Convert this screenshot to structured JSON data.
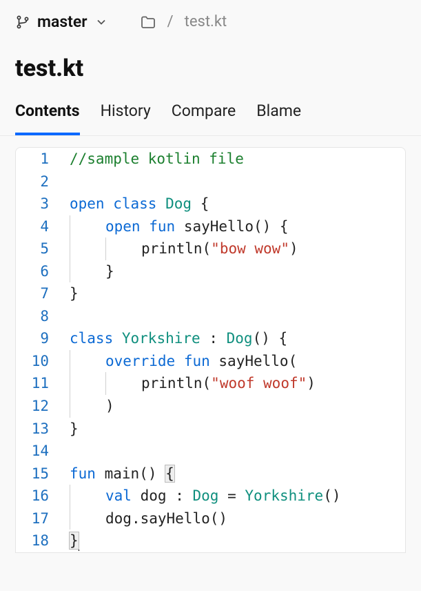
{
  "branch": {
    "name": "master"
  },
  "breadcrumb": {
    "file": "test.kt"
  },
  "title": "test.kt",
  "tabs": [
    {
      "label": "Contents",
      "active": true
    },
    {
      "label": "History",
      "active": false
    },
    {
      "label": "Compare",
      "active": false
    },
    {
      "label": "Blame",
      "active": false
    }
  ],
  "code": {
    "lines": [
      {
        "n": 1,
        "indent": 0,
        "guides": [],
        "tokens": [
          {
            "t": "comment",
            "v": "//sample kotlin file"
          }
        ]
      },
      {
        "n": 2,
        "indent": 0,
        "guides": [],
        "tokens": []
      },
      {
        "n": 3,
        "indent": 0,
        "guides": [],
        "tokens": [
          {
            "t": "modifier",
            "v": "open"
          },
          {
            "t": "sp",
            "v": " "
          },
          {
            "t": "keyword",
            "v": "class"
          },
          {
            "t": "sp",
            "v": " "
          },
          {
            "t": "type",
            "v": "Dog"
          },
          {
            "t": "sp",
            "v": " "
          },
          {
            "t": "punc",
            "v": "{"
          }
        ]
      },
      {
        "n": 4,
        "indent": 1,
        "guides": [
          0
        ],
        "tokens": [
          {
            "t": "modifier",
            "v": "open"
          },
          {
            "t": "sp",
            "v": " "
          },
          {
            "t": "keyword",
            "v": "fun"
          },
          {
            "t": "sp",
            "v": " "
          },
          {
            "t": "fn",
            "v": "sayHello"
          },
          {
            "t": "punc",
            "v": "() {"
          }
        ]
      },
      {
        "n": 5,
        "indent": 2,
        "guides": [
          0,
          1
        ],
        "tokens": [
          {
            "t": "fn",
            "v": "println"
          },
          {
            "t": "punc",
            "v": "("
          },
          {
            "t": "string",
            "v": "\"bow wow\""
          },
          {
            "t": "punc",
            "v": ")"
          }
        ]
      },
      {
        "n": 6,
        "indent": 1,
        "guides": [
          0
        ],
        "tokens": [
          {
            "t": "punc",
            "v": "}"
          }
        ]
      },
      {
        "n": 7,
        "indent": 0,
        "guides": [],
        "tokens": [
          {
            "t": "punc",
            "v": "}"
          }
        ]
      },
      {
        "n": 8,
        "indent": 0,
        "guides": [],
        "tokens": []
      },
      {
        "n": 9,
        "indent": 0,
        "guides": [],
        "tokens": [
          {
            "t": "keyword",
            "v": "class"
          },
          {
            "t": "sp",
            "v": " "
          },
          {
            "t": "type",
            "v": "Yorkshire"
          },
          {
            "t": "sp",
            "v": " "
          },
          {
            "t": "punc",
            "v": ":"
          },
          {
            "t": "sp",
            "v": " "
          },
          {
            "t": "type",
            "v": "Dog"
          },
          {
            "t": "punc",
            "v": "() {"
          }
        ]
      },
      {
        "n": 10,
        "indent": 1,
        "guides": [
          0
        ],
        "tokens": [
          {
            "t": "modifier",
            "v": "override"
          },
          {
            "t": "sp",
            "v": " "
          },
          {
            "t": "keyword",
            "v": "fun"
          },
          {
            "t": "sp",
            "v": " "
          },
          {
            "t": "fn",
            "v": "sayHello"
          },
          {
            "t": "punc",
            "v": "("
          }
        ]
      },
      {
        "n": 11,
        "indent": 2,
        "guides": [
          0,
          1
        ],
        "tokens": [
          {
            "t": "fn",
            "v": "println"
          },
          {
            "t": "punc",
            "v": "("
          },
          {
            "t": "string",
            "v": "\"woof woof\""
          },
          {
            "t": "punc",
            "v": ")"
          }
        ]
      },
      {
        "n": 12,
        "indent": 1,
        "guides": [
          0
        ],
        "tokens": [
          {
            "t": "punc",
            "v": ")"
          }
        ]
      },
      {
        "n": 13,
        "indent": 0,
        "guides": [],
        "tokens": [
          {
            "t": "punc",
            "v": "}"
          }
        ]
      },
      {
        "n": 14,
        "indent": 0,
        "guides": [],
        "tokens": []
      },
      {
        "n": 15,
        "indent": 0,
        "guides": [],
        "tokens": [
          {
            "t": "keyword",
            "v": "fun"
          },
          {
            "t": "sp",
            "v": " "
          },
          {
            "t": "fn",
            "v": "main"
          },
          {
            "t": "punc",
            "v": "() "
          },
          {
            "t": "punc",
            "v": "{",
            "hl": true
          }
        ]
      },
      {
        "n": 16,
        "indent": 1,
        "guides": [
          0
        ],
        "tokens": [
          {
            "t": "keyword",
            "v": "val"
          },
          {
            "t": "sp",
            "v": " "
          },
          {
            "t": "fn",
            "v": "dog"
          },
          {
            "t": "sp",
            "v": " "
          },
          {
            "t": "punc",
            "v": ":"
          },
          {
            "t": "sp",
            "v": " "
          },
          {
            "t": "type",
            "v": "Dog"
          },
          {
            "t": "sp",
            "v": " "
          },
          {
            "t": "punc",
            "v": "="
          },
          {
            "t": "sp",
            "v": " "
          },
          {
            "t": "type",
            "v": "Yorkshire"
          },
          {
            "t": "punc",
            "v": "()"
          }
        ]
      },
      {
        "n": 17,
        "indent": 1,
        "guides": [
          0
        ],
        "tokens": [
          {
            "t": "fn",
            "v": "dog"
          },
          {
            "t": "punc",
            "v": "."
          },
          {
            "t": "fn",
            "v": "sayHello"
          },
          {
            "t": "punc",
            "v": "()"
          }
        ]
      },
      {
        "n": 18,
        "indent": 0,
        "guides": [],
        "tokens": [
          {
            "t": "punc",
            "v": "}",
            "hl": true
          },
          {
            "t": "caret",
            "v": ""
          }
        ]
      }
    ]
  }
}
